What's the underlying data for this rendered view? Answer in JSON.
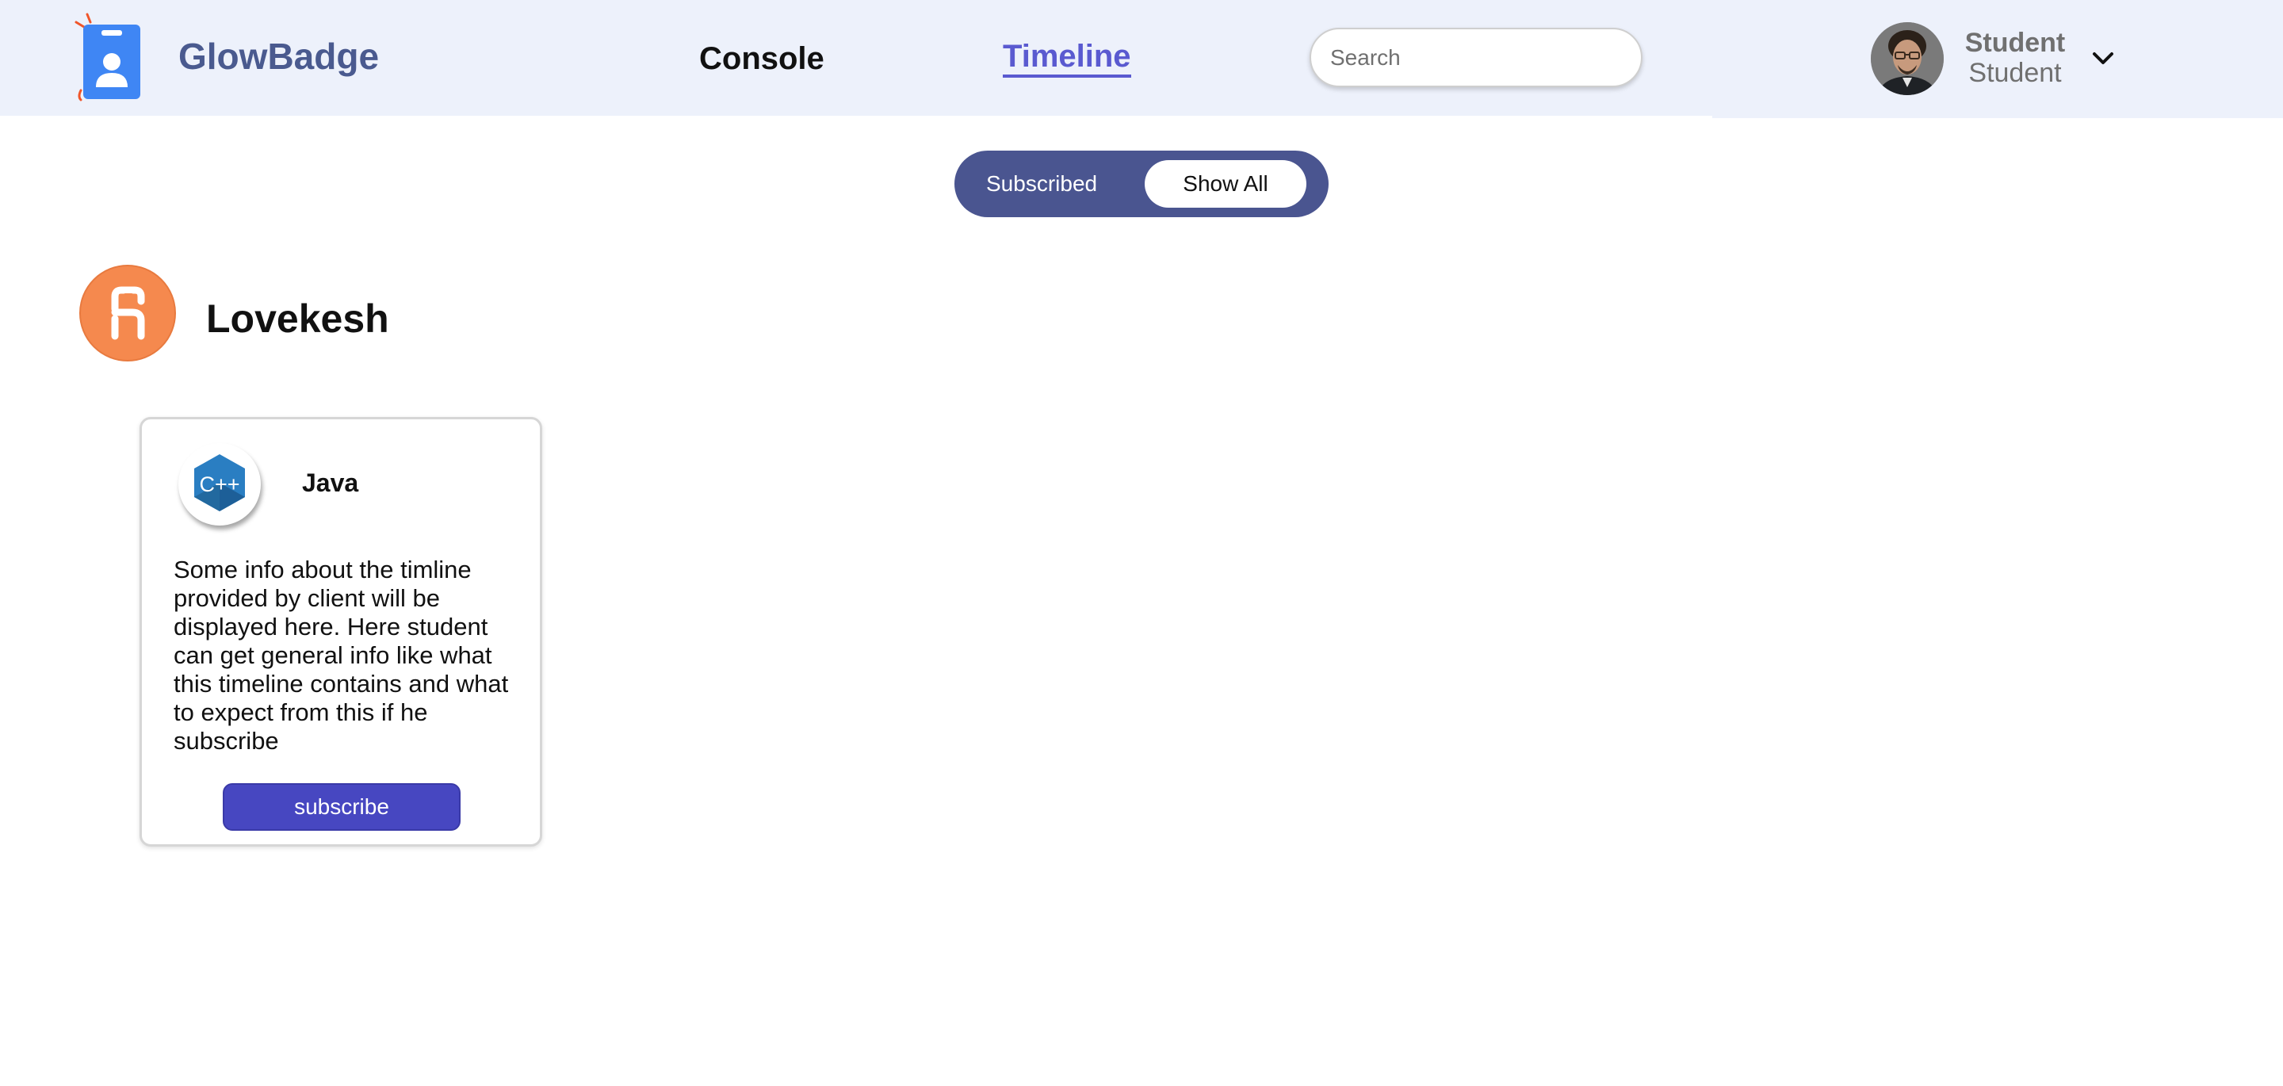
{
  "header": {
    "brand": "GlowBadge",
    "logo_icon": "id-badge-icon",
    "nav": {
      "console": "Console",
      "timeline": "Timeline"
    },
    "search": {
      "placeholder": "Search",
      "value": ""
    },
    "user": {
      "name": "Student",
      "role": "Student",
      "avatar": "user-avatar-photo"
    },
    "menu_icon": "chevron-down-icon"
  },
  "filter": {
    "subscribed_label": "Subscribed",
    "show_all_label": "Show All",
    "active": "Show All"
  },
  "author": {
    "name": "Lovekesh",
    "logo_icon": "author-logo-icon"
  },
  "courses": [
    {
      "title": "Java",
      "icon_text": "C++",
      "icon": "cpp-hexagon-icon",
      "description": "Some info about the timline provided by client will be displayed here. Here student can get general info like what this timeline contains and what to expect from this if he subscribe",
      "button_label": "subscribe"
    }
  ],
  "colors": {
    "header_bg": "#edf1fb",
    "brand": "#4a5a8f",
    "nav_active": "#5a5ad0",
    "toggle_bg": "#4a5590",
    "subscribe_btn": "#4747c1",
    "author_logo": "#f5894e",
    "logo_blue": "#3f86f4",
    "logo_spark": "#f0552a"
  }
}
